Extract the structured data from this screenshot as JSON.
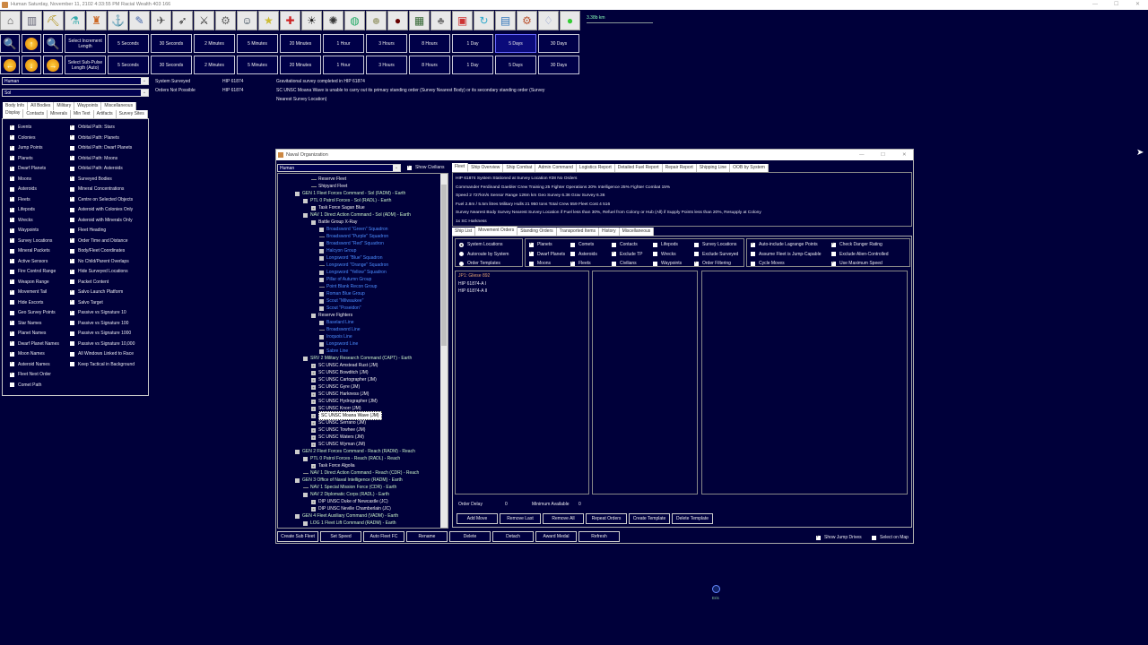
{
  "app_title": "Human   Saturday, November 11, 2102 4:33:55 PM   Racial Wealth 403 166",
  "toolbar_icons": [
    "colony-icon",
    "industry-icon",
    "mining-icon",
    "research-icon",
    "wealth-icon",
    "shipyard-icon",
    "class-design-icon",
    "fleet-icon",
    "missile-icon",
    "ground-forces-icon",
    "turret-icon",
    "commander-icon",
    "medal-icon",
    "race-flag-icon",
    "system-view-icon",
    "galaxy-icon",
    "globe-icon",
    "intelligence-icon",
    "species-icon",
    "circuit-icon",
    "events-icon",
    "calendar-icon",
    "refresh-icon",
    "save-icon",
    "settings-icon",
    "lamp-icon",
    "green-orb-icon"
  ],
  "scale_label": "3.38b km",
  "increment": {
    "label": "Select Increment Length",
    "options": [
      "5 Seconds",
      "30 Seconds",
      "2 Minutes",
      "5 Minutes",
      "20 Minutes",
      "1 Hour",
      "3 Hours",
      "8 Hours",
      "1 Day",
      "5 Days",
      "30 Days"
    ],
    "selected": "5 Days"
  },
  "subpulse": {
    "label": "Select Sub-Pulse Length (Auto)",
    "options": [
      "5 Seconds",
      "30 Seconds",
      "2 Minutes",
      "5 Minutes",
      "20 Minutes",
      "1 Hour",
      "3 Hours",
      "8 Hours",
      "1 Day",
      "5 Days",
      "30 Days"
    ]
  },
  "race_select": "Human",
  "system_select": "Sol",
  "events": [
    {
      "type": "System Surveyed",
      "system": "HIP 61874",
      "text": "Gravitational survey completed in HIP 61874"
    },
    {
      "type": "Orders Not Possible",
      "system": "HIP 61874",
      "text": "SC UNSC Moana Wave is unable to carry out its primary standing order (Survey Nearest Body) or its secondary standing order (Survey",
      "text2": "Nearest Survey Location)"
    }
  ],
  "left_tabs_row1": [
    "Body Info",
    "All Bodies",
    "Military",
    "Waypoints",
    "Miscellaneous"
  ],
  "left_tabs_row2": [
    "Display",
    "Contacts",
    "Minerals",
    "Min Text",
    "Artifacts",
    "Survey Sites"
  ],
  "display_col1": [
    [
      "Events",
      1
    ],
    [
      "Colonies",
      1
    ],
    [
      "Jump Points",
      1
    ],
    [
      "Planets",
      1
    ],
    [
      "Dwarf Planets",
      1
    ],
    [
      "Moons",
      1
    ],
    [
      "Asteroids",
      0
    ],
    [
      "Fleets",
      1
    ],
    [
      "Lifepods",
      1
    ],
    [
      "Wrecks",
      1
    ],
    [
      "Waypoints",
      1
    ],
    [
      "Survey Locations",
      1
    ],
    [
      "Mineral Packets",
      0
    ],
    [
      "Active Sensors",
      1
    ],
    [
      "Fire Control Range",
      0
    ],
    [
      "Weapon Range",
      1
    ],
    [
      "Movement Tail",
      1
    ],
    [
      "Hide Escorts",
      0
    ],
    [
      "Geo Survey Points",
      0
    ],
    [
      "Star Names",
      1
    ],
    [
      "Planet Names",
      1
    ],
    [
      "Dwarf Planet Names",
      1
    ],
    [
      "Moon Names",
      1
    ],
    [
      "Asteroid Names",
      1
    ],
    [
      "Fleet Next Order",
      1
    ],
    [
      "Comet Path",
      0
    ]
  ],
  "display_col2": [
    [
      "Orbital Path: Stars",
      1
    ],
    [
      "Orbital Path: Planets",
      1
    ],
    [
      "Orbital Path: Dwarf Planets",
      0
    ],
    [
      "Orbital Path: Moons",
      1
    ],
    [
      "Orbital Path: Asteroids",
      0
    ],
    [
      "Surveyed Bodies",
      1
    ],
    [
      "Mineral Concentrations",
      0
    ],
    [
      "Centre on Selected Objects",
      1
    ],
    [
      "Asteroid with Colonies Only",
      0
    ],
    [
      "Asteroid with Minerals Only",
      0
    ],
    [
      "Fleet Heading",
      0
    ],
    [
      "Order Time and Distance",
      1
    ],
    [
      "Body/Fleet Coordinates",
      0
    ],
    [
      "No Child/Parent Overlaps",
      1
    ],
    [
      "Hide Surveyed Locations",
      1
    ],
    [
      "Packet Content",
      0
    ],
    [
      "Salvo Launch Platform",
      1
    ],
    [
      "Salvo Target",
      1
    ],
    [
      "Passive vs Signature 10",
      1
    ],
    [
      "Passive vs Signature 100",
      0
    ],
    [
      "Passive vs Signature 1000",
      0
    ],
    [
      "Passive vs Signature 10,000",
      0
    ],
    [
      "All Windows Linked to Race",
      0
    ],
    [
      "Keep Tactical in Background",
      0
    ]
  ],
  "naval": {
    "title": "Naval Organization",
    "race": "Human",
    "show_civilians": "Show Civilians",
    "tree": [
      [
        3,
        "n",
        "w",
        "Reserve Fleet"
      ],
      [
        3,
        "n",
        "w",
        "Shipyard Fleet"
      ],
      [
        1,
        "b",
        "g",
        "GEN 1 Fleet Forces Command - Sol  (FADM)  -  Earth"
      ],
      [
        2,
        "b",
        "g",
        "PTL 0 Patrol Forces - Sol  (RADL)  -  Earth"
      ],
      [
        3,
        "p",
        "w",
        "Task Force Sagan Blue"
      ],
      [
        2,
        "b",
        "g",
        "NAV 1 Direct Action Command - Sol  (ADM)  -  Earth"
      ],
      [
        3,
        "b",
        "w",
        "Battle Group X-Ray"
      ],
      [
        4,
        "b",
        "u",
        "Broadsword \"Green\" Squadron"
      ],
      [
        4,
        "n",
        "u",
        "Broadsword \"Purple\" Squadron"
      ],
      [
        4,
        "b",
        "u",
        "Broadsword \"Red\" Squadron"
      ],
      [
        4,
        "b",
        "u",
        "Halcyon Group"
      ],
      [
        4,
        "b",
        "u",
        "Longsword \"Blue\" Squadron"
      ],
      [
        4,
        "n",
        "u",
        "Longsword \"Orange\" Squadron"
      ],
      [
        4,
        "b",
        "u",
        "Longsword \"Yellow\" Squadron"
      ],
      [
        4,
        "b",
        "u",
        "Pillar of Autumn Group"
      ],
      [
        4,
        "n",
        "u",
        "Point Blank Recon Group"
      ],
      [
        4,
        "b",
        "u",
        "Roman Blue Group"
      ],
      [
        4,
        "b",
        "u",
        "Scout \"Milwaukee\""
      ],
      [
        4,
        "b",
        "u",
        "Scout \"Poseidon\""
      ],
      [
        3,
        "b",
        "w",
        "Reserve Fighters"
      ],
      [
        4,
        "b",
        "u",
        "Baselard Line"
      ],
      [
        4,
        "n",
        "u",
        "Broadsword Line"
      ],
      [
        4,
        "b",
        "u",
        "Iroquois Line"
      ],
      [
        4,
        "b",
        "u",
        "Longsword Line"
      ],
      [
        4,
        "b",
        "u",
        "Sabre Line"
      ],
      [
        2,
        "b",
        "g",
        "SRV 2 Military Research Command  (CAPT)  -  Earth"
      ],
      [
        3,
        "p",
        "w",
        "SC UNSC Amstead Rust  (JM)"
      ],
      [
        3,
        "p",
        "w",
        "SC UNSC Bowditch  (JM)"
      ],
      [
        3,
        "p",
        "w",
        "SC UNSC Cartographer  (JM)"
      ],
      [
        3,
        "p",
        "w",
        "SC UNSC Gyre  (JM)"
      ],
      [
        3,
        "p",
        "w",
        "SC UNSC Harkness  (JM)"
      ],
      [
        3,
        "p",
        "w",
        "SC UNSC Hydrographer  (JM)"
      ],
      [
        3,
        "p",
        "w",
        "SC UNSC Knorr  (JM)"
      ],
      [
        3,
        "p",
        "s",
        "SC UNSC Moana Wave  (JM)"
      ],
      [
        3,
        "p",
        "w",
        "SC UNSC Serrano  (JM)"
      ],
      [
        3,
        "p",
        "w",
        "SC UNSC Towhee  (JM)"
      ],
      [
        3,
        "p",
        "w",
        "SC UNSC Waters  (JM)"
      ],
      [
        3,
        "p",
        "w",
        "SC UNSC Wyman  (JM)"
      ],
      [
        1,
        "b",
        "g",
        "GEN 2 Fleet Forces Command - Reach  (RADM)  -  Reach"
      ],
      [
        2,
        "b",
        "g",
        "PTL 0 Patrol Forces - Reach  (RADL)  -  Reach"
      ],
      [
        3,
        "p",
        "w",
        "Task Force Algolia"
      ],
      [
        2,
        "n",
        "g",
        "NAV 1 Direct Action Command - Reach  (CDR)  -  Reach"
      ],
      [
        1,
        "b",
        "g",
        "GEN 3 Office of Naval Intelligence  (RADM)  -  Earth"
      ],
      [
        2,
        "n",
        "g",
        "NAV 1 Special Mission Force  (CDR)  -  Earth"
      ],
      [
        2,
        "b",
        "g",
        "NAV 2 Diplomatic Corps  (RADL)  -  Earth"
      ],
      [
        3,
        "p",
        "w",
        "DIP UNSC Duke of Newcastle  (JC)"
      ],
      [
        3,
        "p",
        "w",
        "DIP UNSC Neville Chamberlain  (JC)"
      ],
      [
        1,
        "b",
        "g",
        "GEN 4 Fleet Auxiliary Command  (VADM)  -  Earth"
      ],
      [
        2,
        "b",
        "g",
        "LOG 1 Fleet Lift Command  (RADM)  -  Earth"
      ]
    ],
    "tabs": [
      "Fleet",
      "Ship Overview",
      "Ship Combat",
      "Admin Command",
      "Logistics Report",
      "Detailed Fuel Report",
      "Repair Report",
      "Shipping Line",
      "OOB by System"
    ],
    "info": [
      "HIP 61874 System     Stationed at Survey Location #28     No Orders",
      "Commander Ferdinand Gaebler     Crew Training 25     Fighter Operations 20%     Intelligence 25%     Fighter Combat 15%",
      "Speed 2 727km/s     Sensor Range 126m  km     Geo Survey 6.36     Grav Survey 6.36",
      "Fuel 2.8m / 5.5m litres     Military Hulls 21 950 tons     Total Crew 559     Fleet Cost 4 516",
      "Survey Nearest Body     Survey Nearest Survey Location     if Fuel less than 30%, Refuel from Colony or Hub (All)     if Supply Points less than 20%, Resupply at Colony",
      "1x SC Harkness"
    ],
    "subtabs": [
      "Ship List",
      "Movement Orders",
      "Standing Orders",
      "Transported Items",
      "History",
      "Miscellaneous"
    ],
    "radios": [
      [
        "System Locations",
        1
      ],
      [
        "Autoroute by System",
        0
      ],
      [
        "Order Templates",
        0
      ]
    ],
    "filters": [
      [
        [
          "Planets",
          1
        ],
        [
          "Dwarf Planets",
          1
        ],
        [
          "Moons",
          0
        ]
      ],
      [
        [
          "Comets",
          0
        ],
        [
          "Asteroids",
          0
        ],
        [
          "Fleets",
          1
        ]
      ],
      [
        [
          "Contacts",
          0
        ],
        [
          "Exclude TP",
          1
        ],
        [
          "Civilians",
          0
        ]
      ],
      [
        [
          "Lifepods",
          0
        ],
        [
          "Wrecks",
          0
        ],
        [
          "Waypoints",
          0
        ]
      ],
      [
        [
          "Survey Locations",
          0
        ],
        [
          "Exclude Surveyed",
          0
        ],
        [
          "Order Filtering",
          1
        ]
      ]
    ],
    "options": [
      [
        [
          "Auto-include Lagrange Points",
          1
        ],
        [
          "Assume Fleet is Jump-Capable",
          0
        ],
        [
          "Cycle Moves",
          0
        ]
      ],
      [
        [
          "Check Danger Rating",
          1
        ],
        [
          "Exclude Alien-Controlled",
          0
        ],
        [
          "Use Maximum Speed",
          1
        ]
      ]
    ],
    "locations": [
      "JP1: Gliese 892",
      "HIP 61874-A I",
      "HIP 61874-A II"
    ],
    "order_delay_label": "Order Delay",
    "order_delay": "0",
    "min_avail_label": "Minimum Available",
    "min_avail": "0",
    "order_buttons": [
      "Add Move",
      "Remove Last",
      "Remove All",
      "Repeat Orders",
      "Create Template",
      "Delete Template"
    ],
    "bottom_buttons": [
      "Create Sub Fleet",
      "Set Speed",
      "Auto Fleet FC",
      "Rename",
      "Delete",
      "Detach",
      "Award Medal",
      "Refresh"
    ],
    "show_jump_drives": "Show Jump Drives",
    "select_on_map": "Select on Map"
  },
  "map_body_label": "Eris",
  "colors": {
    "background": "#00003a",
    "squadron": "#4a8cff",
    "command": "#c8f0c8",
    "jump_point": "#e0a070"
  }
}
